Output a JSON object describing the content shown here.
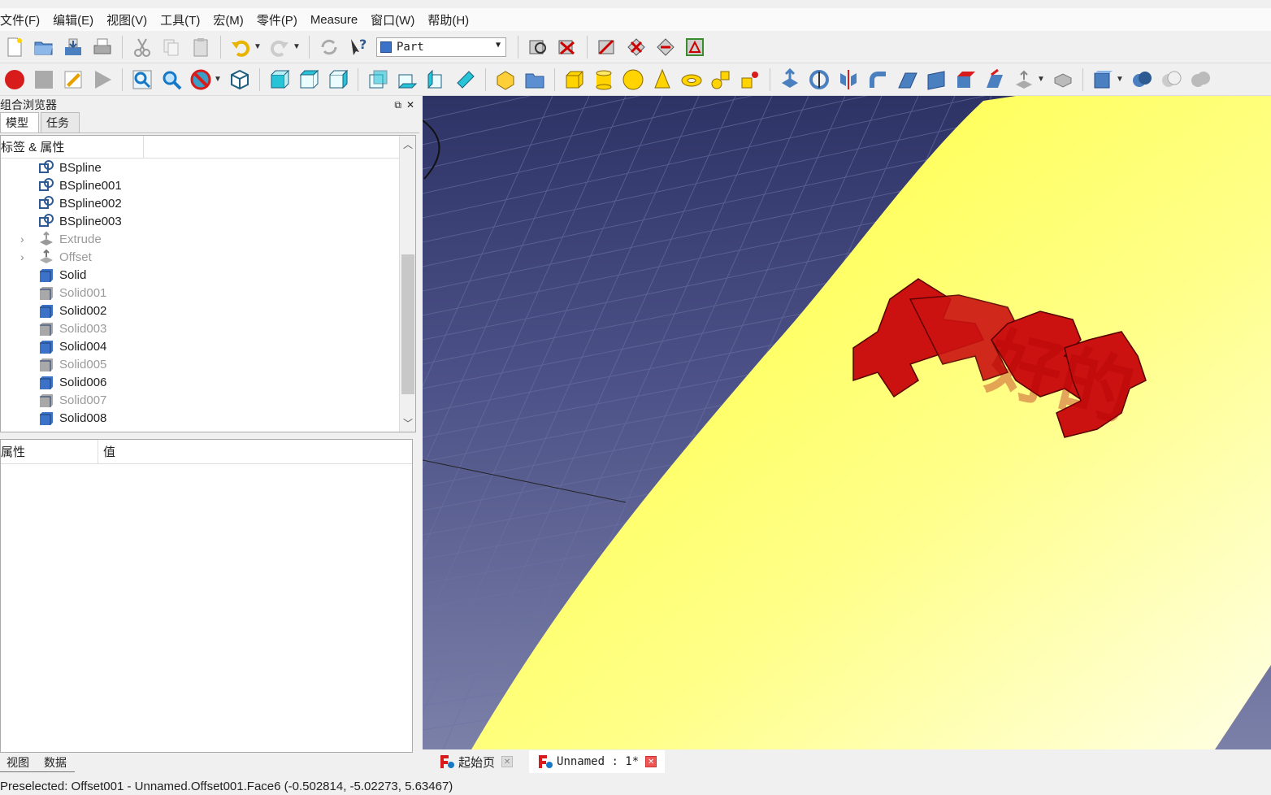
{
  "menu": [
    "文件(F)",
    "编辑(E)",
    "视图(V)",
    "工具(T)",
    "宏(M)",
    "零件(P)",
    "Measure",
    "窗口(W)",
    "帮助(H)"
  ],
  "toolbar": {
    "workbench": "Part"
  },
  "combo": {
    "title": "组合浏览器",
    "tabs": [
      "模型",
      "任务"
    ],
    "tree_header": "标签 & 属性",
    "items": [
      {
        "label": "BSpline",
        "type": "spline",
        "dim": false,
        "expandable": false
      },
      {
        "label": "BSpline001",
        "type": "spline",
        "dim": false,
        "expandable": false
      },
      {
        "label": "BSpline002",
        "type": "spline",
        "dim": false,
        "expandable": false
      },
      {
        "label": "BSpline003",
        "type": "spline",
        "dim": false,
        "expandable": false
      },
      {
        "label": "Extrude",
        "type": "extrude",
        "dim": true,
        "expandable": true
      },
      {
        "label": "Offset",
        "type": "offset",
        "dim": true,
        "expandable": true
      },
      {
        "label": "Solid",
        "type": "solid",
        "dim": false,
        "expandable": false
      },
      {
        "label": "Solid001",
        "type": "solid",
        "dim": true,
        "expandable": false
      },
      {
        "label": "Solid002",
        "type": "solid",
        "dim": false,
        "expandable": false
      },
      {
        "label": "Solid003",
        "type": "solid",
        "dim": true,
        "expandable": false
      },
      {
        "label": "Solid004",
        "type": "solid",
        "dim": false,
        "expandable": false
      },
      {
        "label": "Solid005",
        "type": "solid",
        "dim": true,
        "expandable": false
      },
      {
        "label": "Solid006",
        "type": "solid",
        "dim": false,
        "expandable": false
      },
      {
        "label": "Solid007",
        "type": "solid",
        "dim": true,
        "expandable": false
      },
      {
        "label": "Solid008",
        "type": "solid",
        "dim": false,
        "expandable": false
      }
    ],
    "prop_header": {
      "property": "属性",
      "value": "值"
    },
    "bottom_tabs": [
      "视图",
      "数据"
    ]
  },
  "viewport": {
    "text3d": "好的"
  },
  "doc_tabs": [
    {
      "label": "起始页",
      "active": false
    },
    {
      "label": "Unnamed : 1*",
      "active": true
    }
  ],
  "status": "Preselected: Offset001 - Unnamed.Offset001.Face6 (-0.502814, -5.02273, 5.63467)",
  "colors": {
    "accent_red": "#cc1111",
    "surface_yellow": "#ffff44",
    "bg_top": "#2e3366",
    "bg_bottom": "#7b80a8"
  }
}
